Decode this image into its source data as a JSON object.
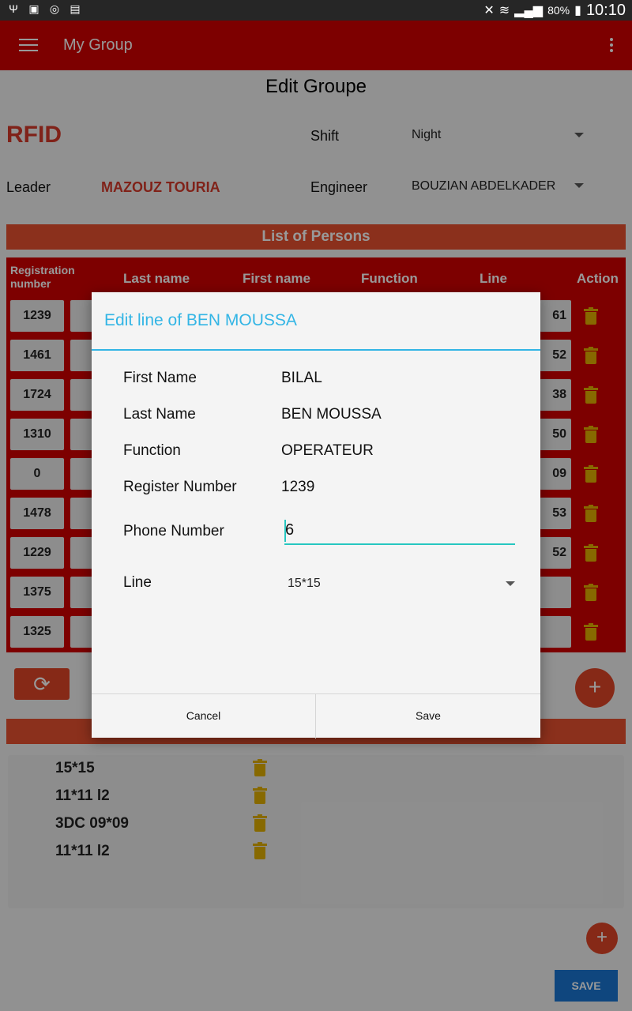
{
  "status_bar": {
    "icons_left": [
      "usb-icon",
      "image-icon",
      "sync-icon",
      "sim-icon"
    ],
    "battery": "80%",
    "time": "10:10"
  },
  "toolbar": {
    "title": "My Group"
  },
  "page": {
    "title": "Edit Groupe",
    "rfid_label": "RFID",
    "shift_label": "Shift",
    "shift_value": "Night",
    "leader_label": "Leader",
    "leader_value": "MAZOUZ TOURIA",
    "engineer_label": "Engineer",
    "engineer_value": "BOUZIAN ABDELKADER"
  },
  "persons": {
    "section_title": "List of Persons",
    "headers": [
      "Registration number",
      "Last name",
      "First name",
      "Function",
      "Line",
      "Action"
    ],
    "rows": [
      {
        "reg": "1239",
        "line": "61"
      },
      {
        "reg": "1461",
        "line": "52"
      },
      {
        "reg": "1724",
        "line": "38"
      },
      {
        "reg": "1310",
        "line": "50"
      },
      {
        "reg": "0",
        "line": "09"
      },
      {
        "reg": "1478",
        "line": "53"
      },
      {
        "reg": "1229",
        "line": "52"
      },
      {
        "reg": "1375",
        "line": ""
      },
      {
        "reg": "1325",
        "line": ""
      }
    ]
  },
  "lines": {
    "items": [
      "15*15",
      "11*11 l2",
      "3DC 09*09",
      "11*11 l2"
    ]
  },
  "actions": {
    "save_label": "SAVE",
    "add_symbol": "+",
    "refresh_symbol": "⟳"
  },
  "dialog": {
    "title": "Edit line of BEN MOUSSA",
    "first_name_label": "First Name",
    "first_name": "BILAL",
    "last_name_label": "Last Name",
    "last_name": "BEN MOUSSA",
    "function_label": "Function",
    "function": "OPERATEUR",
    "register_label": "Register Number",
    "register": "1239",
    "phone_label": "Phone Number",
    "phone": "6",
    "line_label": "Line",
    "line_value": "15*15",
    "cancel_label": "Cancel",
    "save_label": "Save"
  }
}
